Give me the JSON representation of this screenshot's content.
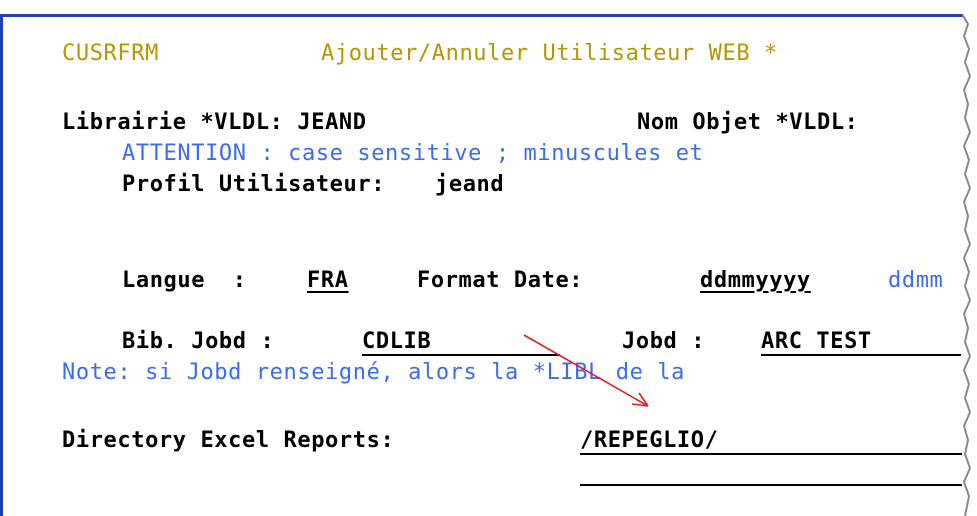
{
  "header": {
    "program": "CUSRFRM",
    "title": "Ajouter/Annuler Utilisateur WEB *"
  },
  "library_row": {
    "label": "Librairie *VLDL: ",
    "value": "JEAND",
    "object_label": "Nom Objet *VLDL:"
  },
  "attention": "ATTENTION : case sensitive ; minuscules et",
  "profile": {
    "label": "Profil Utilisateur:",
    "value": "jeand"
  },
  "language": {
    "label": "Langue  : ",
    "value": "FRA",
    "date_label": "Format Date: ",
    "date_value": "ddmmyyyy",
    "date_hint": "ddmm"
  },
  "jobd": {
    "lib_label": "Bib. Jobd : ",
    "lib_value": "CDLIB",
    "label": "Jobd : ",
    "value": "ARC TEST"
  },
  "note": "Note: si Jobd renseigné, alors la *LIBL de la",
  "excel": {
    "label": "Directory Excel Reports:",
    "value": "/REPEGLIO/"
  },
  "colors": {
    "frame": "#2440b8",
    "info_text": "#3c6cf0",
    "title_text": "#b89600",
    "arrow": "#e02020"
  }
}
